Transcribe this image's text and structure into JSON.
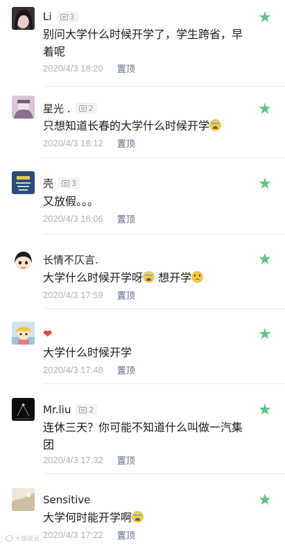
{
  "accent_color": "#5fc186",
  "comments": [
    {
      "name": "Li",
      "count": "3",
      "text": "别问大学什么时候开学了，学生跨省，早着呢",
      "time": "2020/4/3 18:20",
      "pin": "置顶"
    },
    {
      "name": "星光 .",
      "count": "2",
      "text": "只想知道长春的大学什么时候开学",
      "time": "2020/4/3 18:12",
      "pin": "置顶"
    },
    {
      "name": "壳",
      "count": "3",
      "text": "又放假。。。",
      "time": "2020/4/3 18:06",
      "pin": "置顶"
    },
    {
      "name": "长情不仄言.",
      "text_a": "大学什么时候开学呀",
      "text_b": " 想开学",
      "time": "2020/4/3 17:59",
      "pin": "置顶"
    },
    {
      "name_icon": "red-heart-icon",
      "text": "大学什么时候开学",
      "time": "2020/4/3 17:48",
      "pin": "置顶"
    },
    {
      "name": "Mr.liu",
      "count": "2",
      "text": "连休三天？你可能不知道什么叫做一汽集团",
      "time": "2020/4/3 17:32",
      "pin": "置顶"
    },
    {
      "name": "Sensitive",
      "text": "大学何时能开学啊",
      "time": "2020/4/3 17:22",
      "pin": "置顶"
    }
  ],
  "watermark": "大咖说说"
}
